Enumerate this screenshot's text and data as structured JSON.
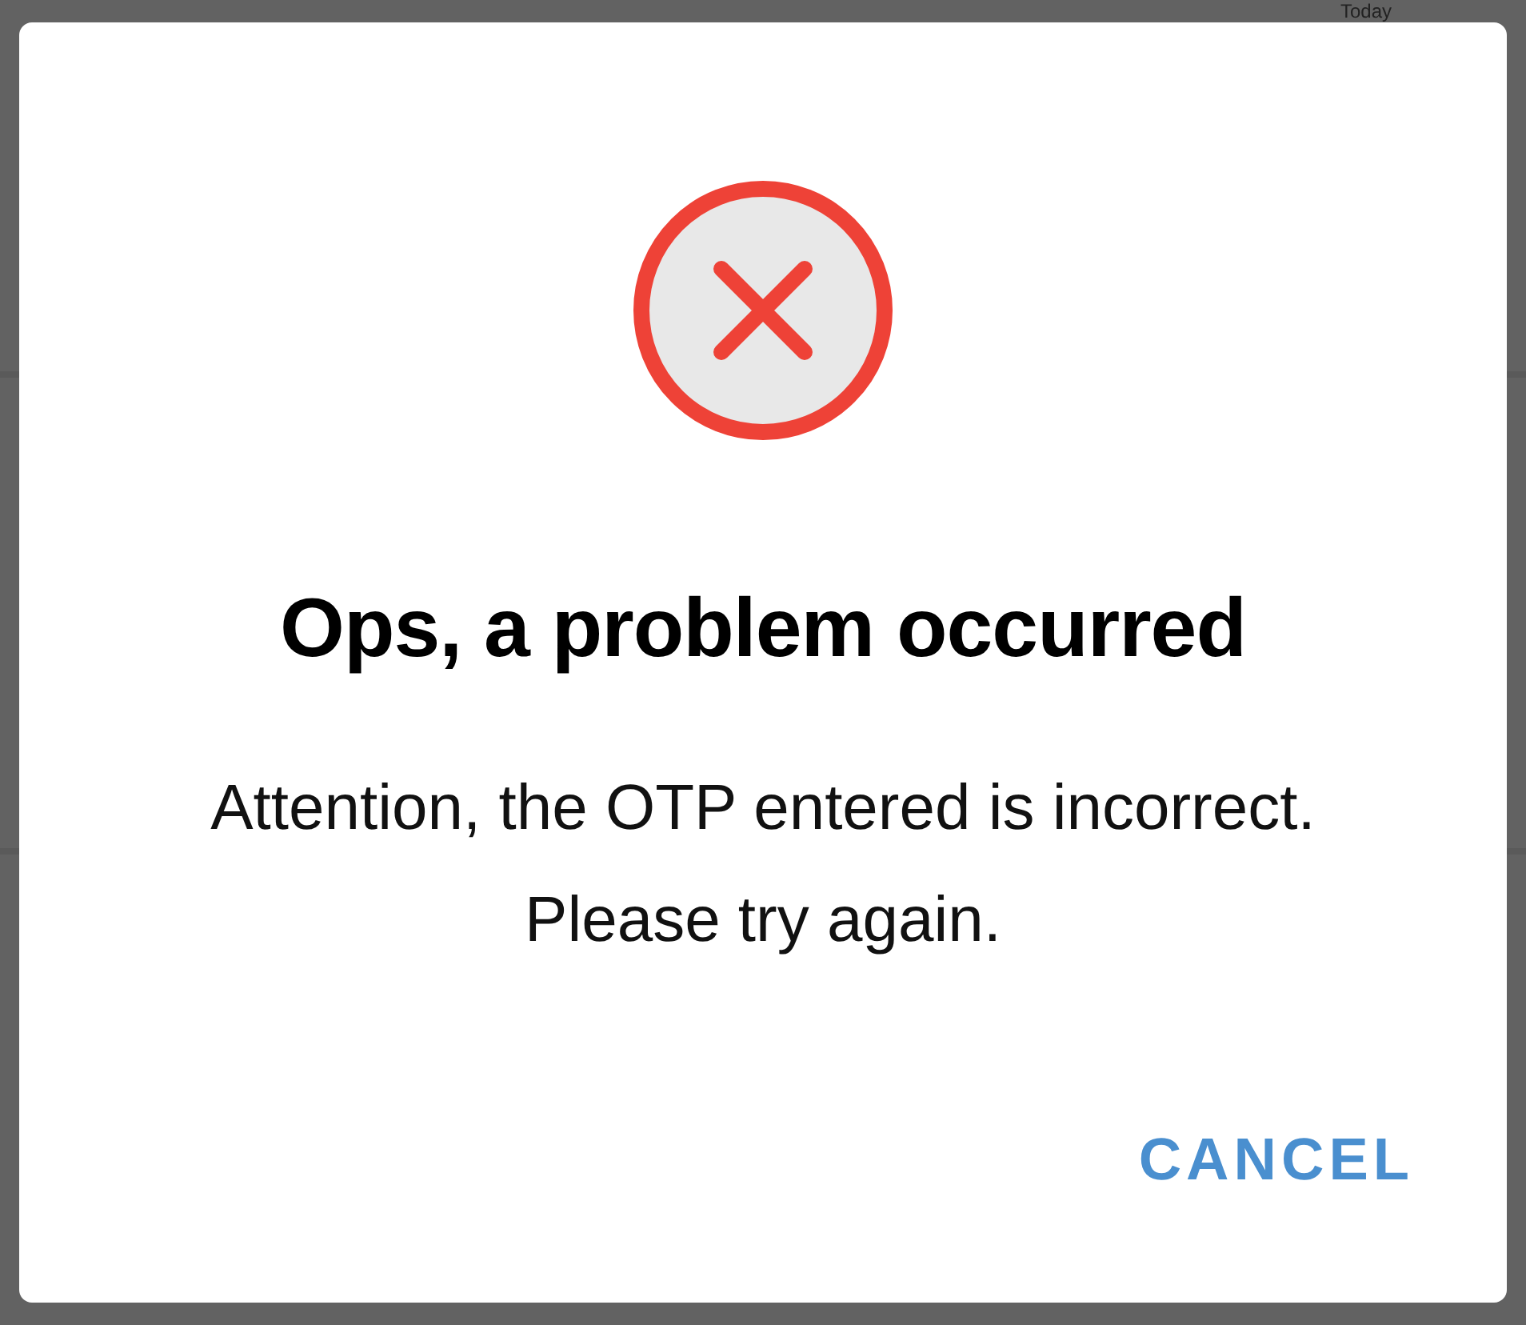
{
  "background": {
    "label": "Today"
  },
  "dialog": {
    "title": "Ops, a problem occurred",
    "message_lines": [
      "Attention, the OTP entered is incorrect.",
      "Please try again."
    ],
    "buttons": [
      {
        "label": "CANCEL"
      }
    ]
  }
}
